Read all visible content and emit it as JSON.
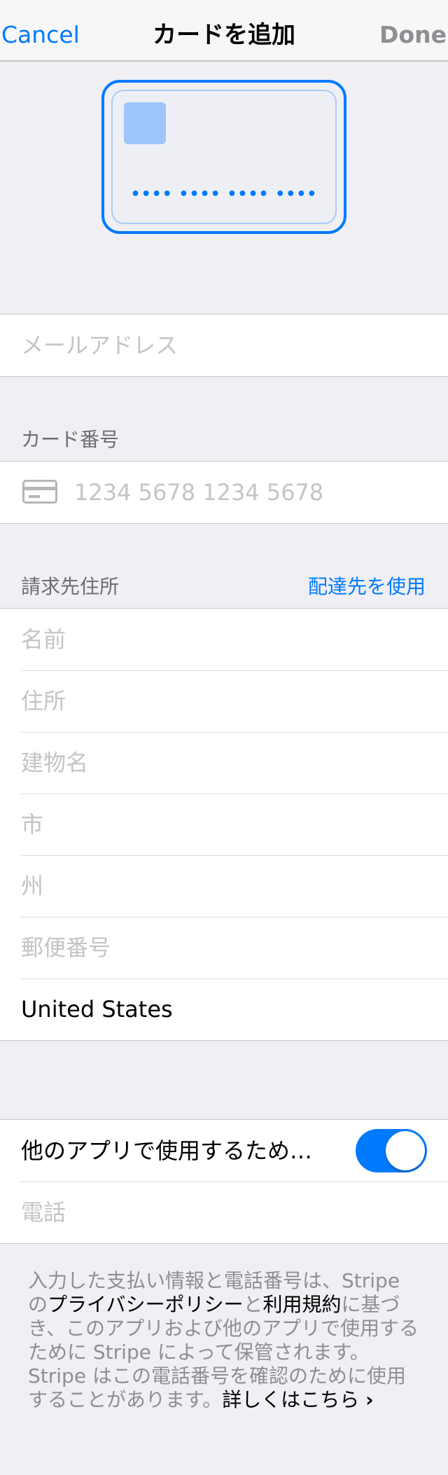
{
  "nav": {
    "cancel": "Cancel",
    "title": "カードを追加",
    "done": "Done"
  },
  "card_preview": {
    "number_mask": "•••• •••• •••• ••••"
  },
  "email": {
    "placeholder": "メールアドレス"
  },
  "card_section": {
    "header": "カード番号",
    "icon": "credit-card-icon",
    "placeholder": "1234 5678 1234 5678"
  },
  "billing": {
    "header": "請求先住所",
    "action": "配達先を使用",
    "fields": [
      "名前",
      "住所",
      "建物名",
      "市",
      "州",
      "郵便番号"
    ],
    "country": "United States"
  },
  "link": {
    "toggle_label": "他のアプリで使用するため…",
    "toggle_on": true,
    "phone_placeholder": "電話"
  },
  "footer": {
    "part1": "入力した支払い情報と電話番号は、Stripe の",
    "privacy": "プライバシーポリシー",
    "part2": "と",
    "terms": "利用規約",
    "part3": "に基づき、このアプリおよび他のアプリで使用するために Stripe によって保管されます。Stripe はこの電話番号を確認のために使用することがあります。",
    "learn_more": "詳しくはこちら",
    "chevron": "›"
  },
  "colors": {
    "accent": "#007aff",
    "background": "#efeff4",
    "placeholder": "#c4c4c9"
  }
}
